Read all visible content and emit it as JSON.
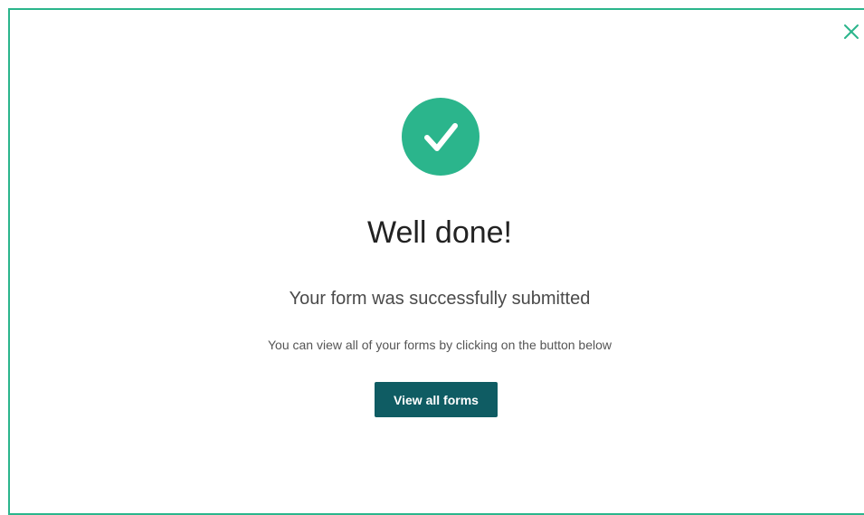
{
  "modal": {
    "close_icon": "close-icon",
    "success_icon": "checkmark-icon",
    "title": "Well done!",
    "subtitle": "Your form was successfully submitted",
    "hint": "You can view all of your forms by clicking on the button below",
    "button_label": "View all forms"
  },
  "colors": {
    "accent": "#2bb58c",
    "button": "#0f5c63",
    "title_text": "#222222"
  }
}
